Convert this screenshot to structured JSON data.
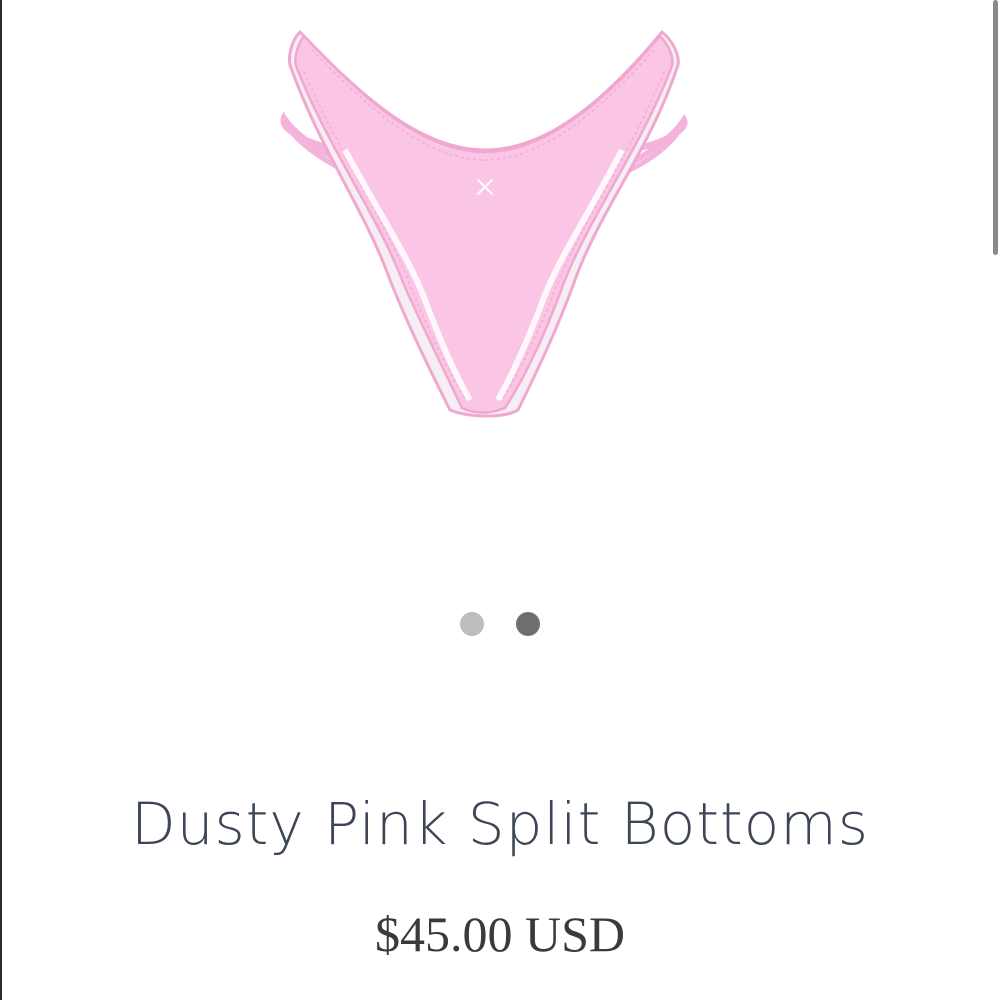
{
  "product": {
    "title": "Dusty Pink Split Bottoms",
    "price": "$45.00 USD",
    "image_icon": "bikini-bottom-illustration",
    "colors": {
      "fabric": "#fbc6e6",
      "stitch": "#f0a8d0",
      "trim": "#f7eef3"
    }
  },
  "carousel": {
    "dots": [
      {
        "state": "inactive",
        "color": "#bdbdbd"
      },
      {
        "state": "active",
        "color": "#6f6f6f"
      }
    ]
  },
  "colors": {
    "title_text": "#3c4654",
    "price_text": "#3a3a3a"
  }
}
